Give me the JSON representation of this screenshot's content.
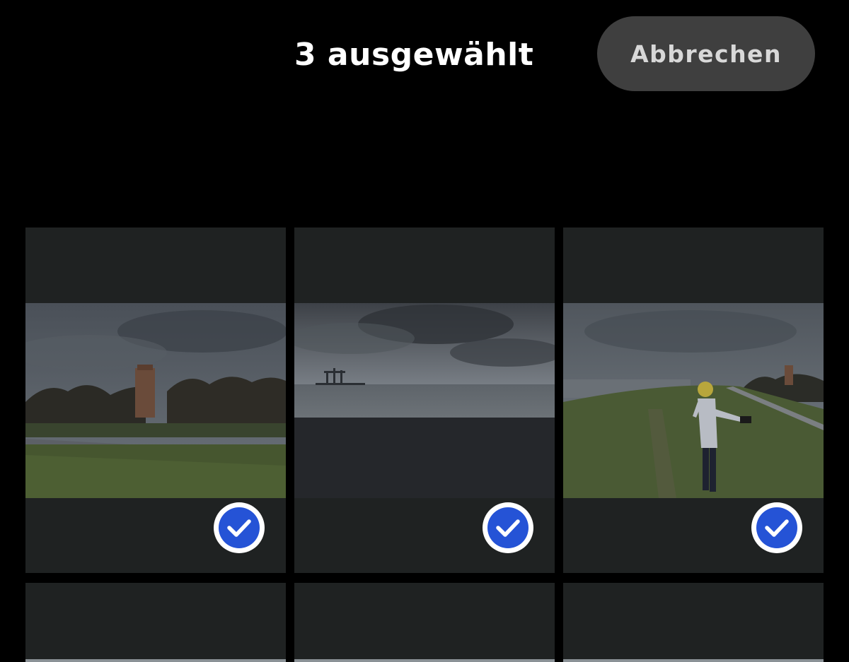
{
  "header": {
    "selected_count_label": "3 ausgewählt",
    "cancel_label": "Abbrechen"
  },
  "grid": {
    "items": [
      {
        "name": "photo-tower-bushes",
        "selected": true,
        "icon": "check-circle-icon"
      },
      {
        "name": "photo-sea-cranes",
        "selected": true,
        "icon": "check-circle-icon"
      },
      {
        "name": "photo-person-dike",
        "selected": true,
        "icon": "check-circle-icon"
      },
      {
        "name": "photo-partial-1",
        "selected": false
      },
      {
        "name": "photo-partial-2",
        "selected": false
      },
      {
        "name": "photo-partial-3",
        "selected": false
      }
    ]
  },
  "colors": {
    "background": "#000000",
    "tile_background": "#1f2222",
    "cancel_button": "#3f3f3f",
    "check_accent": "#2553d6"
  }
}
